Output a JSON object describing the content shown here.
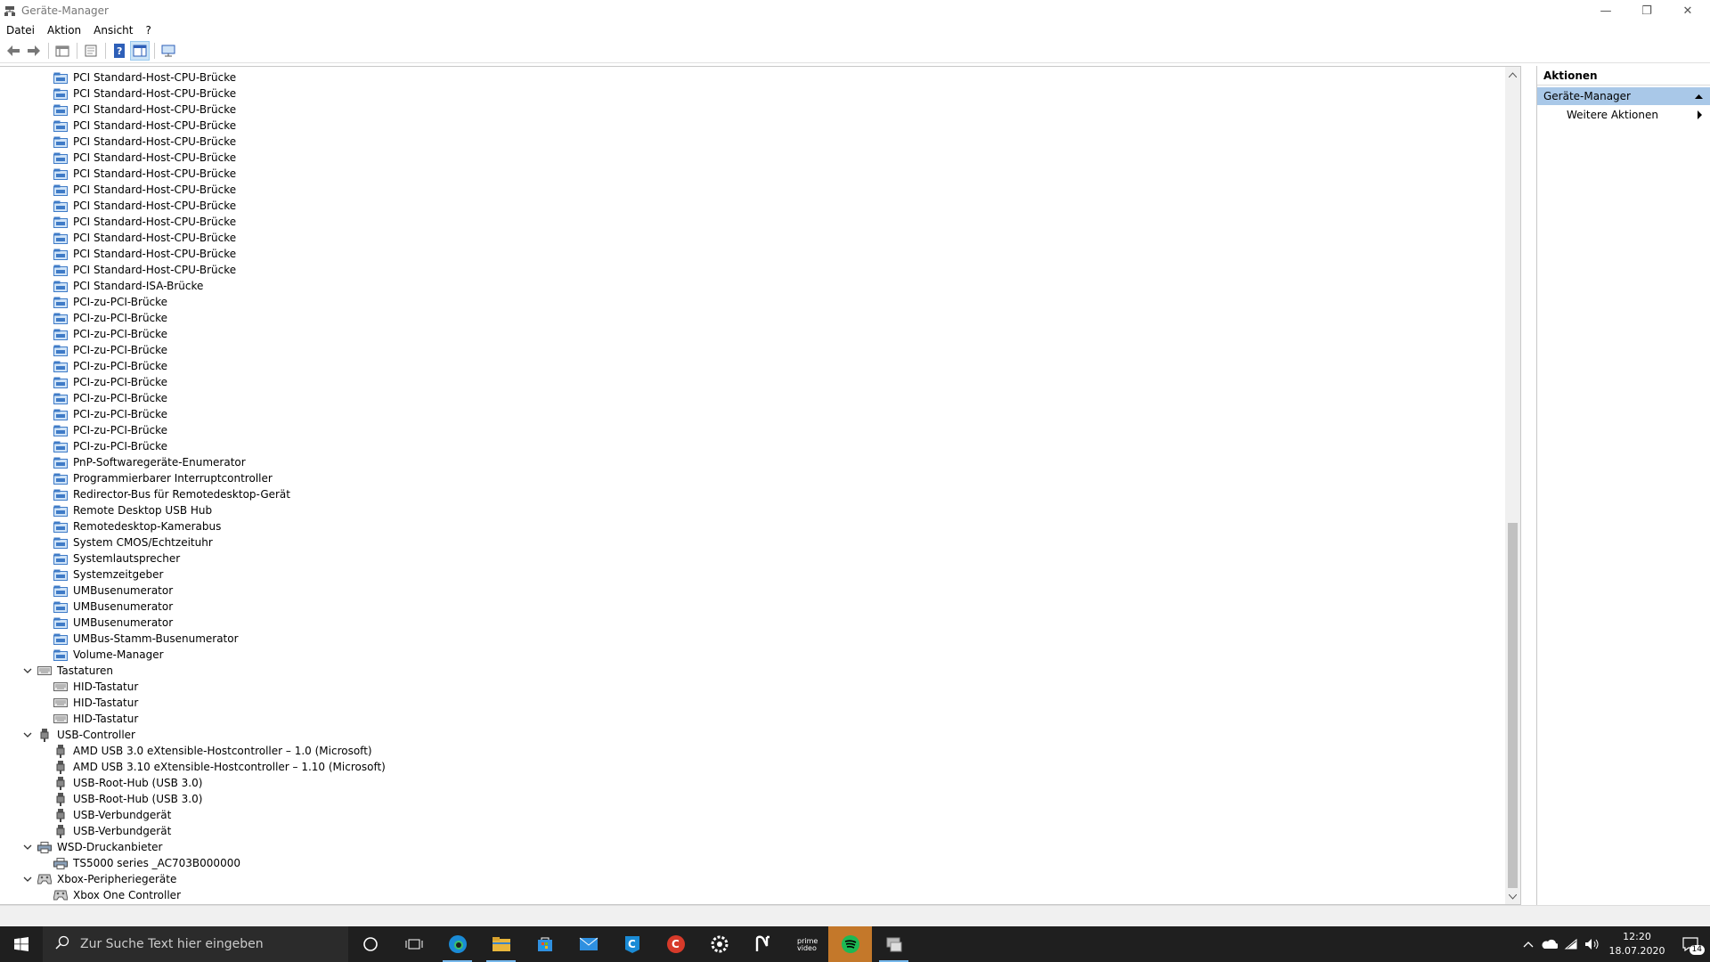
{
  "window": {
    "title": "Geräte-Manager",
    "minimize": "—",
    "maximize": "❐",
    "close": "✕"
  },
  "menu": [
    "Datei",
    "Aktion",
    "Ansicht",
    "?"
  ],
  "tree": [
    {
      "type": "child",
      "icon": "system-device",
      "label": "PCI Standard-Host-CPU-Brücke"
    },
    {
      "type": "child",
      "icon": "system-device",
      "label": "PCI Standard-Host-CPU-Brücke"
    },
    {
      "type": "child",
      "icon": "system-device",
      "label": "PCI Standard-Host-CPU-Brücke"
    },
    {
      "type": "child",
      "icon": "system-device",
      "label": "PCI Standard-Host-CPU-Brücke"
    },
    {
      "type": "child",
      "icon": "system-device",
      "label": "PCI Standard-Host-CPU-Brücke"
    },
    {
      "type": "child",
      "icon": "system-device",
      "label": "PCI Standard-Host-CPU-Brücke"
    },
    {
      "type": "child",
      "icon": "system-device",
      "label": "PCI Standard-Host-CPU-Brücke"
    },
    {
      "type": "child",
      "icon": "system-device",
      "label": "PCI Standard-Host-CPU-Brücke"
    },
    {
      "type": "child",
      "icon": "system-device",
      "label": "PCI Standard-Host-CPU-Brücke"
    },
    {
      "type": "child",
      "icon": "system-device",
      "label": "PCI Standard-Host-CPU-Brücke"
    },
    {
      "type": "child",
      "icon": "system-device",
      "label": "PCI Standard-Host-CPU-Brücke"
    },
    {
      "type": "child",
      "icon": "system-device",
      "label": "PCI Standard-Host-CPU-Brücke"
    },
    {
      "type": "child",
      "icon": "system-device",
      "label": "PCI Standard-Host-CPU-Brücke"
    },
    {
      "type": "child",
      "icon": "system-device",
      "label": "PCI Standard-ISA-Brücke"
    },
    {
      "type": "child",
      "icon": "system-device",
      "label": "PCI-zu-PCI-Brücke"
    },
    {
      "type": "child",
      "icon": "system-device",
      "label": "PCI-zu-PCI-Brücke"
    },
    {
      "type": "child",
      "icon": "system-device",
      "label": "PCI-zu-PCI-Brücke"
    },
    {
      "type": "child",
      "icon": "system-device",
      "label": "PCI-zu-PCI-Brücke"
    },
    {
      "type": "child",
      "icon": "system-device",
      "label": "PCI-zu-PCI-Brücke"
    },
    {
      "type": "child",
      "icon": "system-device",
      "label": "PCI-zu-PCI-Brücke"
    },
    {
      "type": "child",
      "icon": "system-device",
      "label": "PCI-zu-PCI-Brücke"
    },
    {
      "type": "child",
      "icon": "system-device",
      "label": "PCI-zu-PCI-Brücke"
    },
    {
      "type": "child",
      "icon": "system-device",
      "label": "PCI-zu-PCI-Brücke"
    },
    {
      "type": "child",
      "icon": "system-device",
      "label": "PCI-zu-PCI-Brücke"
    },
    {
      "type": "child",
      "icon": "system-device",
      "label": "PnP-Softwaregeräte-Enumerator"
    },
    {
      "type": "child",
      "icon": "system-device",
      "label": "Programmierbarer Interruptcontroller"
    },
    {
      "type": "child",
      "icon": "system-device",
      "label": "Redirector-Bus für Remotedesktop-Gerät"
    },
    {
      "type": "child",
      "icon": "system-device",
      "label": "Remote Desktop USB Hub"
    },
    {
      "type": "child",
      "icon": "system-device",
      "label": "Remotedesktop-Kamerabus"
    },
    {
      "type": "child",
      "icon": "system-device",
      "label": "System CMOS/Echtzeituhr"
    },
    {
      "type": "child",
      "icon": "system-device",
      "label": "Systemlautsprecher"
    },
    {
      "type": "child",
      "icon": "system-device",
      "label": "Systemzeitgeber"
    },
    {
      "type": "child",
      "icon": "system-device",
      "label": "UMBusenumerator"
    },
    {
      "type": "child",
      "icon": "system-device",
      "label": "UMBusenumerator"
    },
    {
      "type": "child",
      "icon": "system-device",
      "label": "UMBusenumerator"
    },
    {
      "type": "child",
      "icon": "system-device",
      "label": "UMBus-Stamm-Busenumerator"
    },
    {
      "type": "child",
      "icon": "system-device",
      "label": "Volume-Manager"
    },
    {
      "type": "cat",
      "icon": "keyboard",
      "label": "Tastaturen"
    },
    {
      "type": "child",
      "icon": "keyboard",
      "label": "HID-Tastatur"
    },
    {
      "type": "child",
      "icon": "keyboard",
      "label": "HID-Tastatur"
    },
    {
      "type": "child",
      "icon": "keyboard",
      "label": "HID-Tastatur"
    },
    {
      "type": "cat",
      "icon": "usb",
      "label": "USB-Controller"
    },
    {
      "type": "child",
      "icon": "usb",
      "label": "AMD USB 3.0 eXtensible-Hostcontroller – 1.0 (Microsoft)"
    },
    {
      "type": "child",
      "icon": "usb",
      "label": "AMD USB 3.10 eXtensible-Hostcontroller – 1.10 (Microsoft)"
    },
    {
      "type": "child",
      "icon": "usb",
      "label": "USB-Root-Hub (USB 3.0)"
    },
    {
      "type": "child",
      "icon": "usb",
      "label": "USB-Root-Hub (USB 3.0)"
    },
    {
      "type": "child",
      "icon": "usb",
      "label": "USB-Verbundgerät"
    },
    {
      "type": "child",
      "icon": "usb",
      "label": "USB-Verbundgerät"
    },
    {
      "type": "cat",
      "icon": "printer",
      "label": "WSD-Druckanbieter"
    },
    {
      "type": "child",
      "icon": "printer",
      "label": "TS5000 series _AC703B000000"
    },
    {
      "type": "cat",
      "icon": "gamepad",
      "label": "Xbox-Peripheriegeräte"
    },
    {
      "type": "child",
      "icon": "gamepad",
      "label": "Xbox One Controller"
    }
  ],
  "actions": {
    "header": "Aktionen",
    "section": "Geräte-Manager",
    "more": "Weitere Aktionen"
  },
  "taskbar": {
    "search_placeholder": "Zur Suche Text hier eingeben",
    "time": "12:20",
    "date": "18.07.2020",
    "notification_count": "14"
  },
  "colors": {
    "accent": "#2e7bd1",
    "selection": "#a9c8e8",
    "taskbar": "#1f1f1f",
    "spotify": "#1db954"
  }
}
